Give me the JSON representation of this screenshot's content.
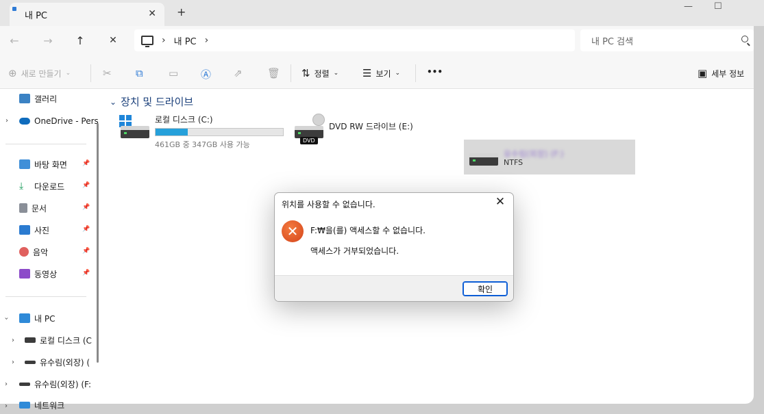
{
  "titlebar": {
    "tab_title": "내 PC",
    "close_tab": "✕",
    "new_tab": "+",
    "minimize": "—",
    "maximize": "☐"
  },
  "addressbar": {
    "back": "←",
    "forward": "→",
    "up": "↑",
    "refresh": "✕",
    "breadcrumb": [
      "내 PC"
    ],
    "search_placeholder": "내 PC 검색"
  },
  "toolbar": {
    "new": "새로 만들기",
    "sort": "정렬",
    "view": "보기",
    "more": "•••",
    "details": "세부 정보"
  },
  "sidebar": {
    "gallery": "갤러리",
    "onedrive": "OneDrive - Pers",
    "quick_access": [
      {
        "label": "바탕 화면",
        "icon": "desktop-icon"
      },
      {
        "label": "다운로드",
        "icon": "download-icon"
      },
      {
        "label": "문서",
        "icon": "document-icon"
      },
      {
        "label": "사진",
        "icon": "pictures-icon"
      },
      {
        "label": "음악",
        "icon": "music-icon"
      },
      {
        "label": "동영상",
        "icon": "video-icon"
      }
    ],
    "this_pc": "내 PC",
    "local_disk": "로컬 디스크 (C",
    "external1": "유수림(외장) (",
    "external2": "유수림(외장) (F:",
    "network": "네트워크"
  },
  "content": {
    "group_title": "장치 및 드라이브",
    "drives": [
      {
        "name": "로컬 디스크 (C:)",
        "free": "461GB 중 347GB 사용 가능",
        "used_fraction": 0.25
      },
      {
        "name": "DVD RW 드라이브 (E:)",
        "badge": "DVD"
      },
      {
        "name": "유수림(외장) (F:)",
        "fs": "NTFS"
      }
    ]
  },
  "dialog": {
    "title": "위치를 사용할 수 없습니다.",
    "message1": "F:₩을(를) 액세스할 수 없습니다.",
    "message2": "액세스가 거부되었습니다.",
    "ok": "확인"
  },
  "colors": {
    "accent": "#26a0da",
    "error": "#d5451b",
    "selection": "#d9d9d9"
  }
}
